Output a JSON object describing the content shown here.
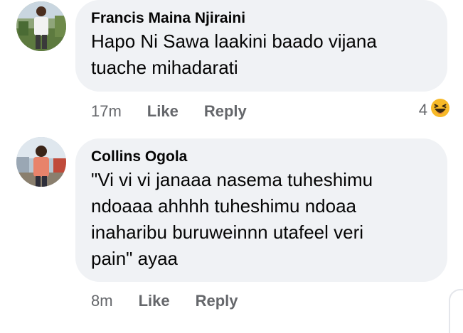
{
  "comments": [
    {
      "author": "Francis Maina Njiraini",
      "text": "Hapo Ni Sawa laakini baado vijana\ntuache mihadarati",
      "time": "17m",
      "like_label": "Like",
      "reply_label": "Reply",
      "reaction_count": "4",
      "reaction_icon": "haha-emoji-icon"
    },
    {
      "author": "Collins Ogola",
      "text": "\"Vi vi vi janaaa nasema tuheshimu\nndoaaa ahhhh tuheshimu ndoaa\ninaharibu  buruweinnn utafeel veri\npain\" ayaa",
      "time": "8m",
      "like_label": "Like",
      "reply_label": "Reply"
    }
  ],
  "colors": {
    "bubble_bg": "#f0f2f5",
    "meta_text": "#65676b",
    "primary_text": "#050505",
    "haha_yellow": "#f7b928"
  }
}
